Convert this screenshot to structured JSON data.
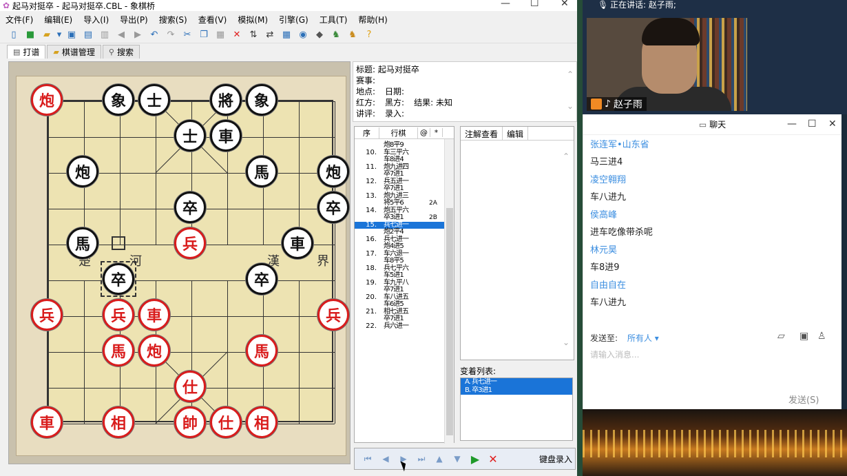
{
  "window": {
    "title": "起马对挺卒 - 起马对挺卒.CBL - 象棋桥",
    "controls": [
      "—",
      "☐",
      "✕"
    ]
  },
  "menu": [
    "文件(F)",
    "编辑(E)",
    "导入(I)",
    "导出(P)",
    "搜索(S)",
    "查看(V)",
    "模拟(M)",
    "引擎(G)",
    "工具(T)",
    "帮助(H)"
  ],
  "toolbar_icons": [
    "new-icon",
    "save-green-icon",
    "open-icon",
    "dropdown-icon",
    "save-icon",
    "print-icon",
    "delete-icon",
    "back-icon",
    "forward-icon",
    "undo-icon",
    "redo-icon",
    "cut-icon",
    "copy-icon",
    "paste-icon",
    "close-red-icon",
    "flip-vertical-icon",
    "flip-horizontal-icon",
    "board-icon",
    "play-circle-icon",
    "tag-icon",
    "engine-icon",
    "engine-pair-icon",
    "help-icon"
  ],
  "tabs": [
    {
      "label": "打谱",
      "icon": "doc-icon"
    },
    {
      "label": "棋谱管理",
      "icon": "folder-icon"
    },
    {
      "label": "搜索",
      "icon": "search-icon"
    }
  ],
  "info": {
    "title": "标题: 起马对挺卒",
    "event": "赛事:",
    "place": "地点:",
    "date": "日期:",
    "red": "红方:",
    "black": "黑方:",
    "result": "结果: 未知",
    "commentator": "讲评:",
    "recorder": "录入:"
  },
  "board": {
    "river_texts": [
      "楚",
      "河",
      "漢",
      "界"
    ],
    "pieces": [
      {
        "char": "炮",
        "color": "red",
        "col": 0,
        "row": 0
      },
      {
        "char": "象",
        "color": "black",
        "col": 2,
        "row": 0
      },
      {
        "char": "士",
        "color": "black",
        "col": 3,
        "row": 0
      },
      {
        "char": "將",
        "color": "black",
        "col": 5,
        "row": 0
      },
      {
        "char": "象",
        "color": "black",
        "col": 6,
        "row": 0
      },
      {
        "char": "士",
        "color": "black",
        "col": 4,
        "row": 1
      },
      {
        "char": "車",
        "color": "black",
        "col": 5,
        "row": 1
      },
      {
        "char": "炮",
        "color": "black",
        "col": 1,
        "row": 2
      },
      {
        "char": "馬",
        "color": "black",
        "col": 6,
        "row": 2
      },
      {
        "char": "炮",
        "color": "black",
        "col": 8,
        "row": 2
      },
      {
        "char": "卒",
        "color": "black",
        "col": 4,
        "row": 3
      },
      {
        "char": "卒",
        "color": "black",
        "col": 8,
        "row": 3
      },
      {
        "char": "馬",
        "color": "black",
        "col": 1,
        "row": 4
      },
      {
        "char": "兵",
        "color": "red",
        "col": 4,
        "row": 4
      },
      {
        "char": "車",
        "color": "black",
        "col": 7,
        "row": 4
      },
      {
        "char": "卒",
        "color": "black",
        "col": 2,
        "row": 5
      },
      {
        "char": "卒",
        "color": "black",
        "col": 6,
        "row": 5
      },
      {
        "char": "兵",
        "color": "red",
        "col": 0,
        "row": 6
      },
      {
        "char": "兵",
        "color": "red",
        "col": 2,
        "row": 6
      },
      {
        "char": "車",
        "color": "red",
        "col": 3,
        "row": 6
      },
      {
        "char": "兵",
        "color": "red",
        "col": 8,
        "row": 6
      },
      {
        "char": "馬",
        "color": "red",
        "col": 2,
        "row": 7
      },
      {
        "char": "炮",
        "color": "red",
        "col": 3,
        "row": 7
      },
      {
        "char": "馬",
        "color": "red",
        "col": 6,
        "row": 7
      },
      {
        "char": "仕",
        "color": "red",
        "col": 4,
        "row": 8
      },
      {
        "char": "車",
        "color": "red",
        "col": 0,
        "row": 9
      },
      {
        "char": "相",
        "color": "red",
        "col": 2,
        "row": 9
      },
      {
        "char": "帥",
        "color": "red",
        "col": 4,
        "row": 9
      },
      {
        "char": "仕",
        "color": "red",
        "col": 5,
        "row": 9
      },
      {
        "char": "相",
        "color": "red",
        "col": 6,
        "row": 9
      }
    ],
    "selected": {
      "col": 2,
      "row": 5
    },
    "origin_marker": {
      "col": 2,
      "row": 4
    }
  },
  "moves": {
    "headers": [
      "序",
      "行棋",
      "@",
      "*"
    ],
    "rows": [
      {
        "n": "",
        "m": "炮8平9",
        "c": ""
      },
      {
        "n": "10.",
        "m": "车三平六",
        "c": ""
      },
      {
        "n": "",
        "m": "车8进4",
        "c": ""
      },
      {
        "n": "11.",
        "m": "炮九进四",
        "c": ""
      },
      {
        "n": "",
        "m": "卒7进1",
        "c": ""
      },
      {
        "n": "12.",
        "m": "兵五进一",
        "c": ""
      },
      {
        "n": "",
        "m": "卒7进1",
        "c": ""
      },
      {
        "n": "13.",
        "m": "炮九进三",
        "c": ""
      },
      {
        "n": "",
        "m": "将5平6",
        "c": "2A"
      },
      {
        "n": "14.",
        "m": "炮五平六",
        "c": ""
      },
      {
        "n": "",
        "m": "卒3进1",
        "c": "2B"
      },
      {
        "n": "15.",
        "m": "兵七进一",
        "c": "",
        "hi": true
      },
      {
        "n": "",
        "m": "炮2平4",
        "c": ""
      },
      {
        "n": "16.",
        "m": "兵七进一",
        "c": ""
      },
      {
        "n": "",
        "m": "炮4进5",
        "c": ""
      },
      {
        "n": "17.",
        "m": "车六退一",
        "c": ""
      },
      {
        "n": "",
        "m": "车8平5",
        "c": ""
      },
      {
        "n": "18.",
        "m": "兵七平六",
        "c": ""
      },
      {
        "n": "",
        "m": "车5进1",
        "c": ""
      },
      {
        "n": "19.",
        "m": "车九平八",
        "c": ""
      },
      {
        "n": "",
        "m": "卒7进1",
        "c": ""
      },
      {
        "n": "20.",
        "m": "车八进五",
        "c": ""
      },
      {
        "n": "",
        "m": "车6进5",
        "c": ""
      },
      {
        "n": "21.",
        "m": "相七进五",
        "c": ""
      },
      {
        "n": "",
        "m": "卒7进1",
        "c": ""
      },
      {
        "n": "22.",
        "m": "兵六进一",
        "c": ""
      }
    ]
  },
  "notes": {
    "tabs": [
      "注解查看",
      "编辑"
    ]
  },
  "variations": {
    "label": "变着列表:",
    "items": [
      "A. 兵七进一",
      "B. 卒3进1"
    ]
  },
  "nav": {
    "keyboard_label": "键盘录入"
  },
  "video": {
    "speaking": "正在讲话: 赵子雨;",
    "name": "赵子雨"
  },
  "chat": {
    "title": "聊天",
    "messages": [
      {
        "user": "张连军•山东省",
        "text": "马三进4"
      },
      {
        "user": "凌空翱翔",
        "text": "车八进九"
      },
      {
        "user": "侯高峰",
        "text": "进车吃像带杀呢"
      },
      {
        "user": "林元昊",
        "text": "车8进9"
      },
      {
        "user": "自由自在",
        "text": "车八进九"
      }
    ],
    "send_to_label": "发送至:",
    "send_to_value": "所有人 ▾",
    "input_placeholder": "请输入消息...",
    "send_button": "发送(S)"
  },
  "colors": {
    "red": "#d91c1c",
    "black": "#111111",
    "highlight": "#1a74d8",
    "link": "#3b8ee0"
  }
}
